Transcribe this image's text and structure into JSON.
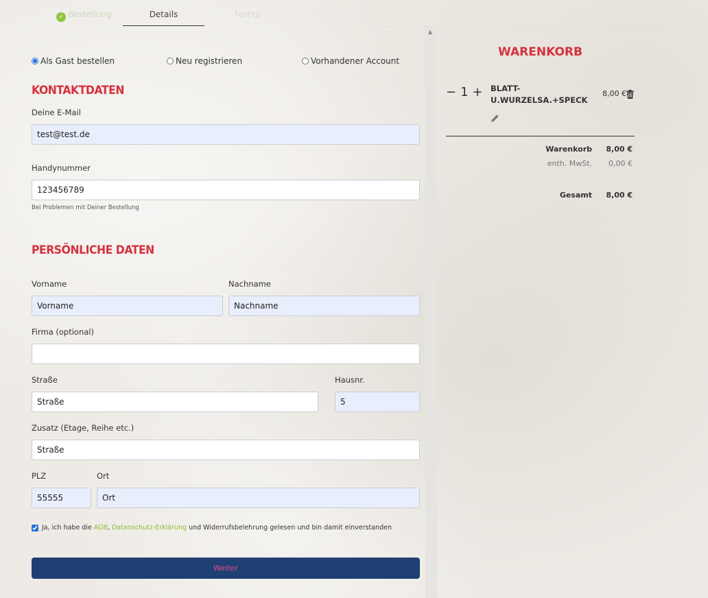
{
  "stepper": {
    "steps": [
      {
        "label": "Bestellung",
        "state": "done"
      },
      {
        "label": "Details",
        "state": "active"
      },
      {
        "label": "Fertig!",
        "state": "upcoming"
      }
    ]
  },
  "account_options": [
    {
      "label": "Als Gast bestellen",
      "checked": true
    },
    {
      "label": "Neu registrieren",
      "checked": false
    },
    {
      "label": "Vorhandener Account",
      "checked": false
    }
  ],
  "contact": {
    "title": "KONTAKTDATEN",
    "email_label": "Deine E-Mail",
    "email_value": "test@test.de",
    "phone_label": "Handynummer",
    "phone_value": "123456789",
    "phone_hint": "Bei Problemen mit Deiner Bestellung"
  },
  "personal": {
    "title": "PERSÖNLICHE DATEN",
    "firstname_label": "Vorname",
    "firstname_value": "Vorname",
    "lastname_label": "Nachname",
    "lastname_value": "Nachname",
    "company_label": "Firma (optional)",
    "company_value": "",
    "street_label": "Straße",
    "street_placeholder": "Straße",
    "housenr_label": "Hausnr.",
    "housenr_value": "5",
    "extra_label": "Zusatz (Etage, Reihe etc.)",
    "extra_placeholder": "Straße",
    "zip_label": "PLZ",
    "zip_value": "55555",
    "city_label": "Ort",
    "city_value": "Ort"
  },
  "consent": {
    "prefix": "Ja, ich habe die ",
    "agb_link": "AGB",
    "sep": ", ",
    "privacy_link": "Datenschutz-Erklärung",
    "suffix": " und Widerrufsbelehrung gelesen und bin damit einverstanden",
    "checked": true
  },
  "submit_label": "Weiter",
  "cart": {
    "title": "WARENKORB",
    "qty_minus": "−",
    "qty_value": "1",
    "qty_plus": "+",
    "item_name": "BLATT-U.WURZELSA.+SPECK",
    "item_price": "8,00 €",
    "subtotal_label": "Warenkorb",
    "subtotal_value": "8,00 €",
    "vat_label": "enth. MwSt.",
    "vat_value": "0,00 €",
    "total_label": "Gesamt",
    "total_value": "8,00 €"
  },
  "colors": {
    "accent_red": "#d5323e",
    "button_blue": "#203f72",
    "link_green": "#8dbb34",
    "input_fill": "#e8eefb"
  }
}
